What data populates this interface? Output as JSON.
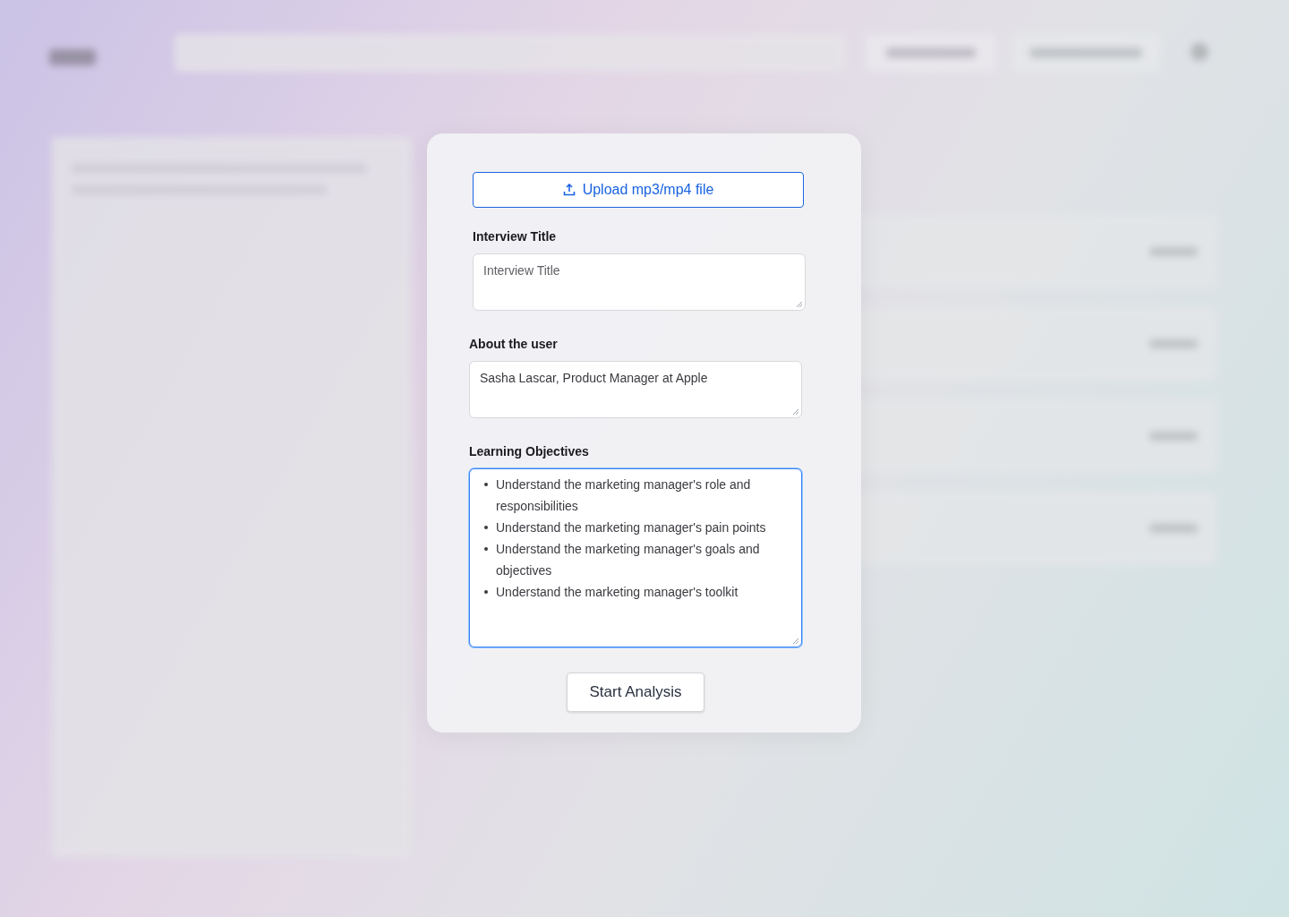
{
  "dialog": {
    "upload_button": "Upload mp3/mp4 file",
    "fields": [
      {
        "label": "Interview Title",
        "placeholder": "Interview Title"
      },
      {
        "label": "About the user",
        "value": "Sasha Lascar, Product Manager at Apple"
      }
    ],
    "objectives": {
      "label": "Learning Objectives",
      "focused": true,
      "items": [
        "Understand the marketing manager's role and responsibilities",
        "Understand the marketing manager's pain points",
        "Understand the marketing manager's goals and objectives",
        "Understand the marketing manager's toolkit"
      ]
    },
    "submit_button": "Start Analysis"
  }
}
